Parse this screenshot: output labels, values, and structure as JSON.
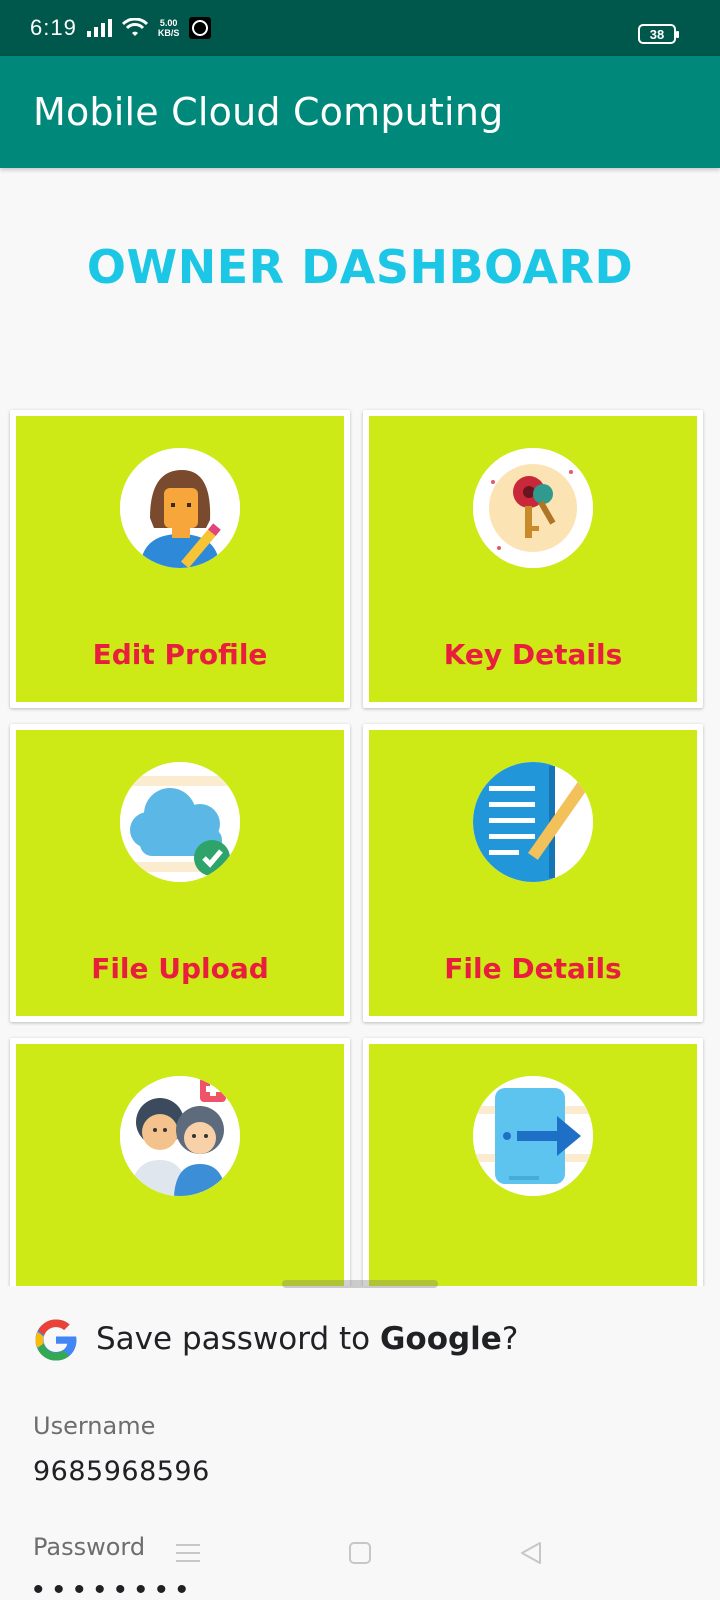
{
  "status_bar": {
    "time": "6:19",
    "net_speed_value": "5.00",
    "net_speed_unit": "KB/S",
    "battery": "38"
  },
  "app_bar": {
    "title": "Mobile Cloud Computing"
  },
  "dashboard": {
    "title": "OWNER DASHBOARD",
    "cards": [
      {
        "label": "Edit Profile",
        "icon": "user-edit-icon"
      },
      {
        "label": "Key Details",
        "icon": "keys-icon"
      },
      {
        "label": "File Upload",
        "icon": "cloud-upload-icon"
      },
      {
        "label": "File Details",
        "icon": "document-icon"
      },
      {
        "label": "",
        "icon": "users-icon"
      },
      {
        "label": "",
        "icon": "logout-icon"
      }
    ]
  },
  "save_password_sheet": {
    "title_prefix": "Save password to ",
    "title_brand": "Google",
    "title_suffix": "?",
    "username_label": "Username",
    "username_value": "9685968596",
    "password_label": "Password",
    "password_value": "••••••••"
  },
  "colors": {
    "status_bar": "#00574b",
    "app_bar": "#00897b",
    "dashboard_title": "#1cc7e6",
    "card_fill": "#cdea16",
    "card_label": "#e91e3f"
  }
}
